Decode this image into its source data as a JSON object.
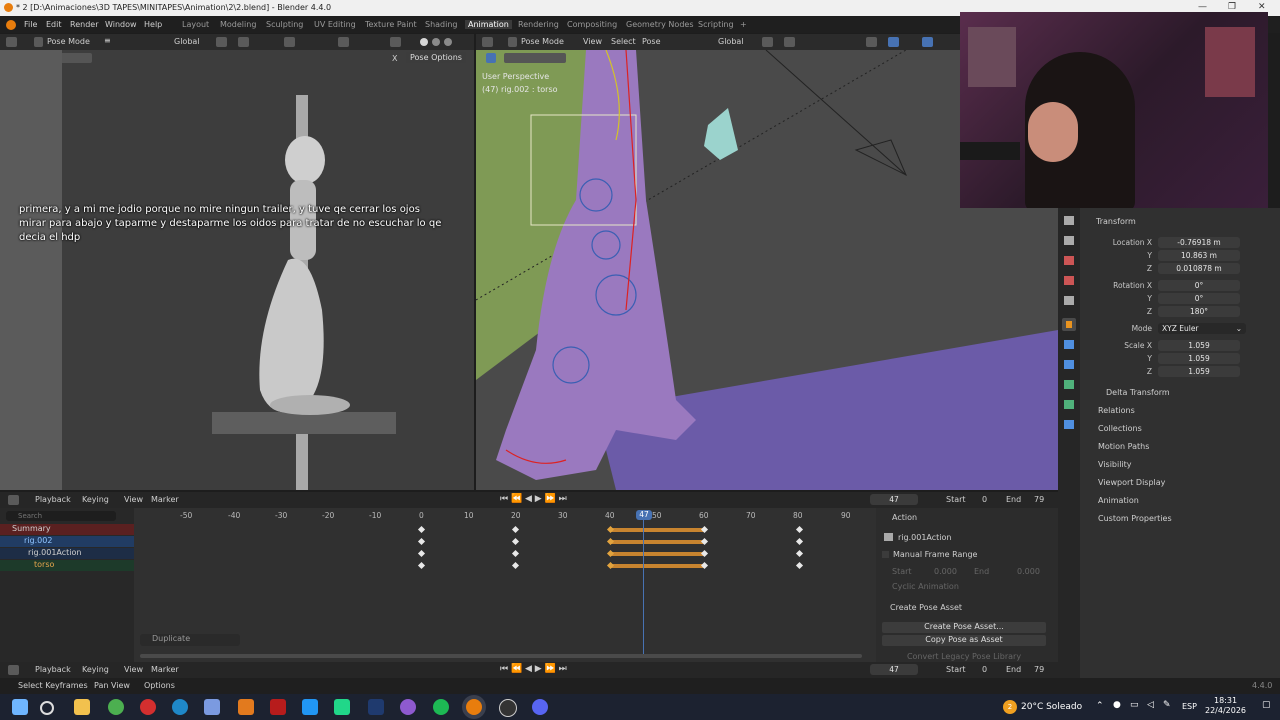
{
  "window": {
    "title": "* 2 [D:\\Animaciones\\3D TAPES\\MINITAPES\\Animation\\2\\2.blend] - Blender 4.4.0",
    "minimize": "—",
    "restore": "❐",
    "close": "✕"
  },
  "menu": {
    "items": [
      "File",
      "Edit",
      "Render",
      "Window",
      "Help"
    ]
  },
  "workspaces": [
    "Layout",
    "Modeling",
    "Sculpting",
    "UV Editing",
    "Texture Paint",
    "Shading",
    "Animation",
    "Rendering",
    "Compositing",
    "Geometry Nodes",
    "Scripting"
  ],
  "workspace_add": "+",
  "left_view": {
    "mode": "Pose Mode",
    "orientation": "Global",
    "pose_options": "Pose Options",
    "x_label": "X"
  },
  "right_view": {
    "mode": "Pose Mode",
    "menu": [
      "View",
      "Select",
      "Pose"
    ],
    "orientation": "Global",
    "perspective": "User Perspective",
    "object_info": "(47) rig.002 : torso"
  },
  "subtitle": "primera, y a mi me jodio porque no mire ningun trailer, y tuve qe cerrar los ojos mirar para abajo y taparme y destaparme los oidos para tratar de no escuchar lo qe decia el hdp",
  "properties": {
    "transform_title": "Transform",
    "location": {
      "label": "Location X",
      "x": "-0.76918 m",
      "y": "10.863 m",
      "z": "0.010878 m"
    },
    "rotation": {
      "label": "Rotation X",
      "x": "0°",
      "y": "0°",
      "z": "180°"
    },
    "mode_label": "Mode",
    "mode_value": "XYZ Euler",
    "scale": {
      "label": "Scale X",
      "x": "1.059",
      "y": "1.059",
      "z": "1.059"
    },
    "axis_y": "Y",
    "axis_z": "Z",
    "delta": "Delta Transform",
    "sections": [
      "Relations",
      "Collections",
      "Motion Paths",
      "Visibility",
      "Viewport Display",
      "Animation",
      "Custom Properties"
    ]
  },
  "timeline_header": {
    "menus": [
      "Playback",
      "Keying",
      "View",
      "Marker"
    ],
    "frame": "47",
    "start_label": "Start",
    "start": "0",
    "end_label": "End",
    "end": "79"
  },
  "dopesheet": {
    "search_placeholder": "Search",
    "channels": [
      "Summary",
      "rig.002",
      "rig.001Action",
      "torso"
    ],
    "ticks": [
      "-50",
      "-40",
      "-30",
      "-20",
      "-10",
      "0",
      "10",
      "20",
      "30",
      "40",
      "50",
      "60",
      "70",
      "80",
      "90"
    ],
    "current_frame": "47",
    "duplicate": "Duplicate"
  },
  "action_panel": {
    "title": "Action",
    "action_name": "rig.001Action",
    "manual_range": "Manual Frame Range",
    "start_label": "Start",
    "start_val": "0.000",
    "end_label": "End",
    "end_val": "0.000",
    "cyclic": "Cyclic Animation",
    "create_title": "Create Pose Asset",
    "create_btn": "Create Pose Asset...",
    "copy_btn": "Copy Pose as Asset",
    "convert_btn": "Convert Legacy Pose Library"
  },
  "bottom_header": {
    "menus": [
      "Playback",
      "Keying",
      "View",
      "Marker"
    ],
    "frame": "47",
    "start_label": "Start",
    "start": "0",
    "end_label": "End",
    "end": "79"
  },
  "statusbar": {
    "items": [
      "Select Keyframes",
      "Pan View",
      "Options"
    ],
    "version": "4.4.0"
  },
  "taskbar": {
    "weather": "20°C  Soleado",
    "lang": "ESP",
    "time": "18:31",
    "date": "22/4/2026",
    "badge": "2"
  },
  "colors": {
    "accent": "#4772b3",
    "keyframe_selected": "#e2a33e",
    "viewport_bg_left": "#3d3d3d",
    "viewport_bg_right": "#4a4a4a"
  }
}
